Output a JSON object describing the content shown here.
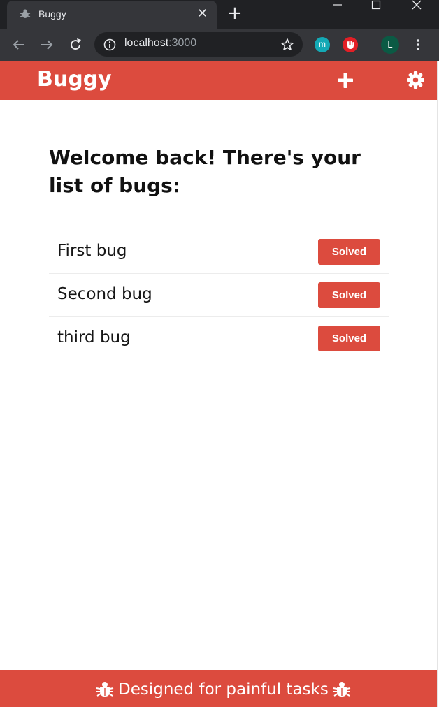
{
  "browser": {
    "tab_title": "Buggy",
    "url_host": "localhost",
    "url_port": ":3000",
    "profile_initial": "L",
    "extension_m_label": "m"
  },
  "app": {
    "brand": "Buggy",
    "welcome": "Welcome back! There's your list of bugs:",
    "accent_color": "#dc4b3e",
    "bugs": [
      {
        "title": "First bug",
        "action_label": "Solved"
      },
      {
        "title": "Second bug",
        "action_label": "Solved"
      },
      {
        "title": "third bug",
        "action_label": "Solved"
      }
    ],
    "footer_text": "Designed for painful tasks"
  }
}
